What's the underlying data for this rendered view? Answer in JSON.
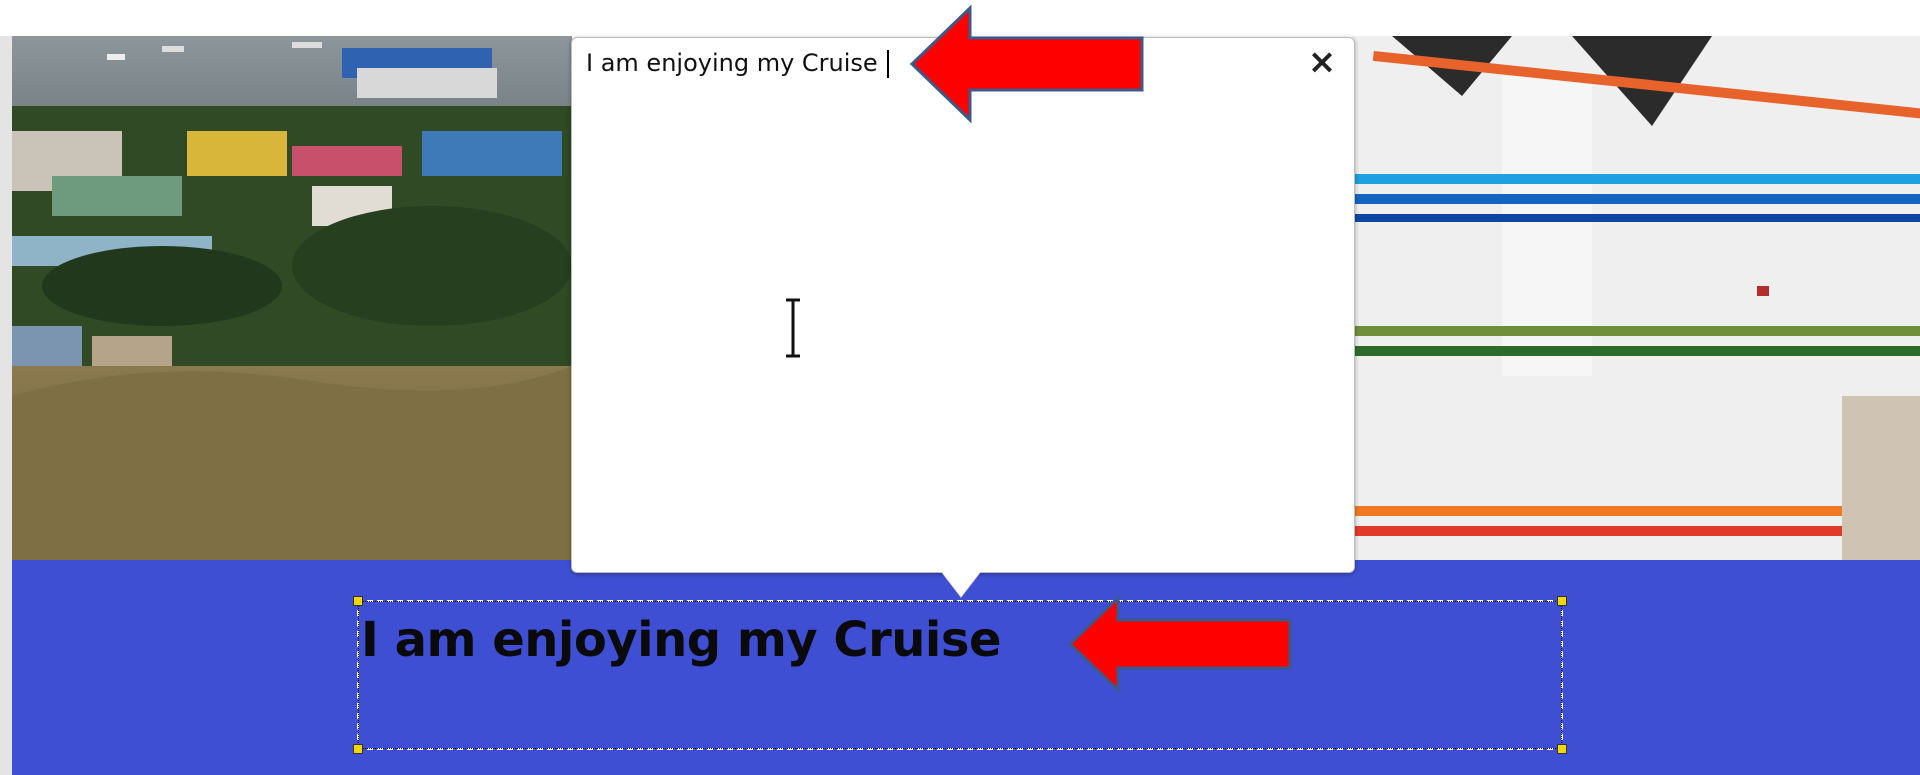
{
  "popup": {
    "text_value": "I am enjoying my Cruise",
    "close_glyph": "×",
    "close_icon": "close-icon"
  },
  "caption": {
    "text": "I am enjoying my Cruise"
  },
  "annotations": {
    "arrow_color": "#ff0000",
    "arrow_outline": "#3b5a8a"
  },
  "colors": {
    "banner": "#3e4fd4",
    "handle": "#f2d600"
  },
  "icons": {
    "cursor": "ibeam-cursor-icon",
    "arrows": "left-arrow-icon"
  }
}
